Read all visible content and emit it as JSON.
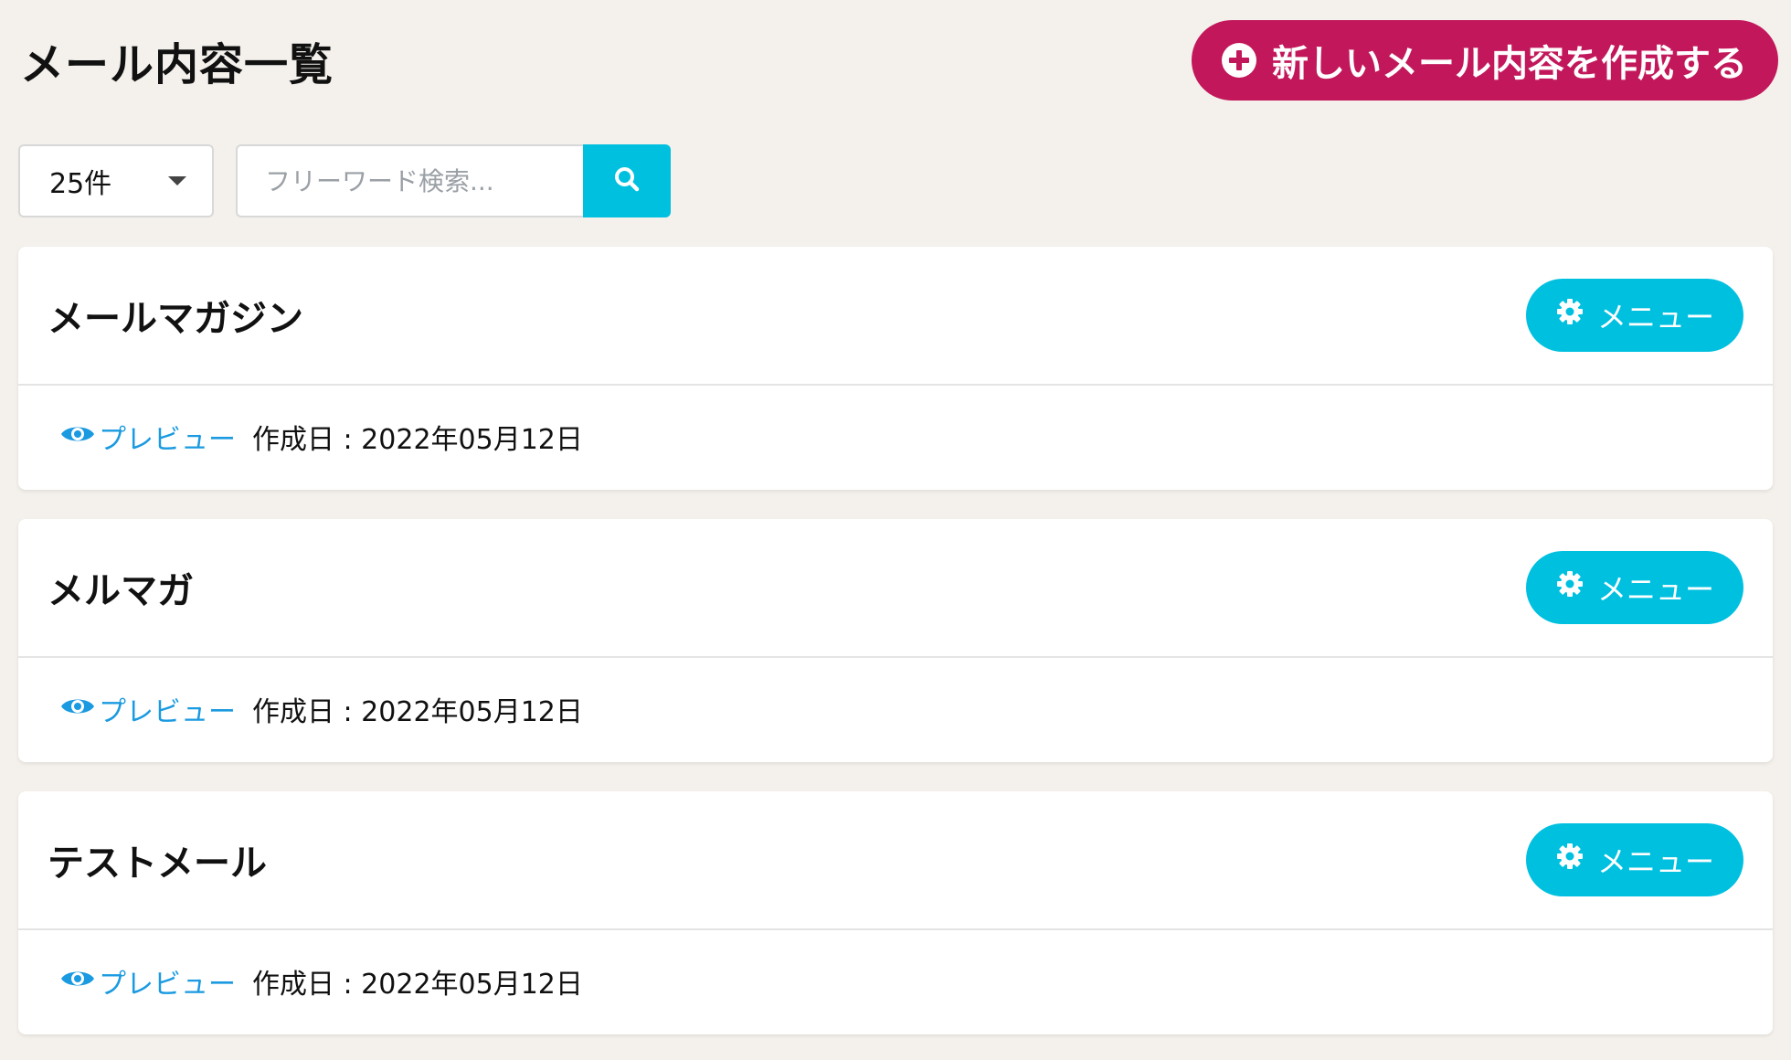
{
  "page": {
    "title": "メール内容一覧",
    "create_button_label": "新しいメール内容を作成する"
  },
  "toolbar": {
    "per_page_value": "25件",
    "search_placeholder": "フリーワード検索...",
    "search_value": ""
  },
  "colors": {
    "background": "#f4f1ec",
    "create_button": "#c2185b",
    "accent": "#00c0e0",
    "link": "#1a9ae0"
  },
  "icons": {
    "create": "plus-circle-icon",
    "search": "search-icon",
    "menu": "gear-icon",
    "preview": "eye-icon",
    "select": "caret-down-icon"
  },
  "cards": [
    {
      "title": "メールマガジン",
      "menu_label": "メニュー",
      "preview_label": "プレビュー",
      "created_label": "作成日 : 2022年05月12日"
    },
    {
      "title": "メルマガ",
      "menu_label": "メニュー",
      "preview_label": "プレビュー",
      "created_label": "作成日 : 2022年05月12日"
    },
    {
      "title": "テストメール",
      "menu_label": "メニュー",
      "preview_label": "プレビュー",
      "created_label": "作成日 : 2022年05月12日"
    }
  ]
}
